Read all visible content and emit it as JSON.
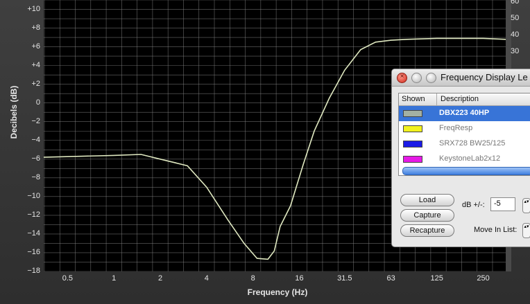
{
  "chart_data": {
    "type": "line",
    "title": "",
    "xlabel": "Frequency (Hz)",
    "ylabel": "Decibels (dB)",
    "x_scale": "log2",
    "xlim": [
      0.35,
      350
    ],
    "ylim": [
      -18,
      11
    ],
    "x_ticks": [
      0.5,
      1,
      2,
      4,
      8,
      16,
      31.5,
      63,
      125,
      250
    ],
    "x_tick_labels": [
      "0.5",
      "1",
      "2",
      "4",
      "8",
      "16",
      "31.5",
      "63",
      "125",
      "250"
    ],
    "y_ticks": [
      -18,
      -16,
      -14,
      -12,
      -10,
      -8,
      -6,
      -4,
      -2,
      0,
      2,
      4,
      6,
      8,
      10
    ],
    "y_tick_labels": [
      "−18",
      "−16",
      "−14",
      "−12",
      "−10",
      "−8",
      "−6",
      "−4",
      "−2",
      "0",
      "+2",
      "+4",
      "+6",
      "+8",
      "+10"
    ],
    "right_tick_labels": [
      "60",
      "50",
      "40",
      "30"
    ],
    "grid": true,
    "background": "#000000",
    "grid_color": "#8a8a8a",
    "series": [
      {
        "name": "DBX223 40HP",
        "color": "#dfe8c0",
        "x": [
          0.35,
          0.6,
          1.0,
          1.5,
          2.0,
          3.0,
          4.0,
          5.5,
          7.0,
          8.5,
          10.0,
          11.0,
          12.0,
          14.0,
          17.0,
          20.0,
          25.0,
          31.5,
          40.0,
          50.0,
          63.0,
          80.0,
          125.0,
          250.0,
          350.0
        ],
        "y": [
          -5.8,
          -5.7,
          -5.6,
          -5.5,
          -6.0,
          -6.7,
          -9.0,
          -12.5,
          -15.0,
          -16.6,
          -16.7,
          -15.8,
          -13.2,
          -11.0,
          -6.5,
          -3.0,
          0.5,
          3.5,
          5.7,
          6.5,
          6.7,
          6.8,
          6.9,
          6.9,
          6.8
        ]
      }
    ]
  },
  "window": {
    "title": "Frequency Display Le",
    "close_glyph": "×",
    "columns": {
      "shown": "Shown",
      "description": "Description"
    },
    "rows": [
      {
        "label": "DBX223 40HP",
        "swatch": "#a3b0a3",
        "selected": true
      },
      {
        "label": "FreqResp",
        "swatch": "#f2f21e",
        "selected": false
      },
      {
        "label": "SRX728 BW25/125",
        "swatch": "#1a1ae6",
        "selected": false
      },
      {
        "label": "KeystoneLab2x12",
        "swatch": "#e61ae6",
        "selected": false
      }
    ],
    "buttons": {
      "load": "Load",
      "capture": "Capture",
      "recapture": "Recapture"
    },
    "db_label": "dB +/-:",
    "db_value": "-5",
    "move_label": "Move In List:",
    "stepper_glyph": "▴▾"
  }
}
